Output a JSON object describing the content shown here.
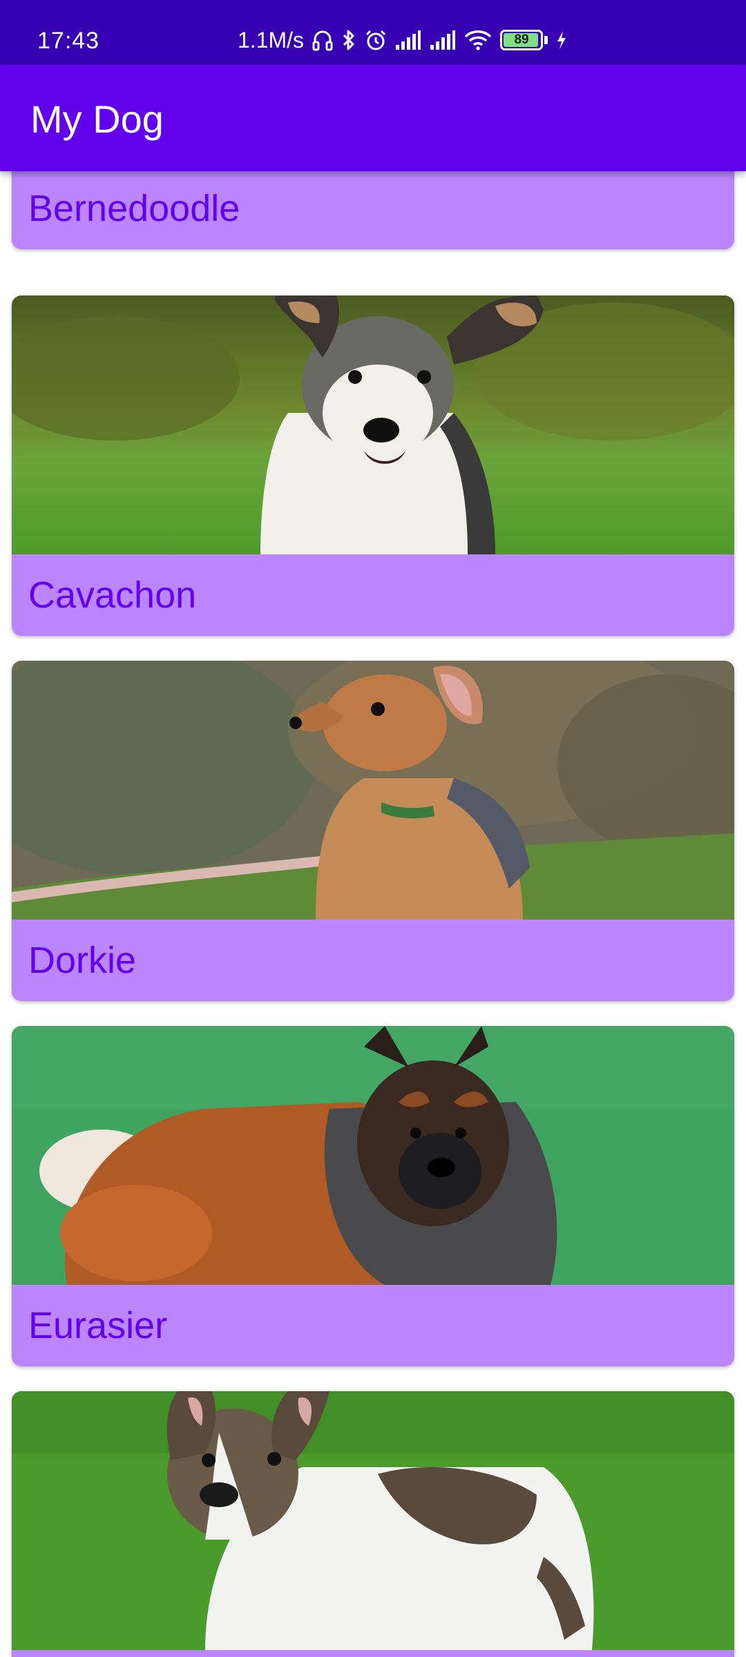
{
  "status_bar": {
    "time": "17:43",
    "net_speed": "1.1M/s",
    "battery_level": "89",
    "icons": [
      "headphones-icon",
      "bluetooth-icon",
      "alarm-icon",
      "signal-icon",
      "signal-icon",
      "wifi-icon",
      "battery-icon",
      "charging-icon"
    ]
  },
  "app_bar": {
    "title": "My Dog"
  },
  "dogs": [
    {
      "name": "Bernedoodle"
    },
    {
      "name": "Cavachon"
    },
    {
      "name": "Dorkie"
    },
    {
      "name": "Eurasier"
    },
    {
      "name": ""
    }
  ],
  "colors": {
    "status_bar": "#3700B3",
    "app_bar": "#6200EE",
    "card_label_bg": "#BB86FC",
    "card_label_text": "#6200EE"
  }
}
